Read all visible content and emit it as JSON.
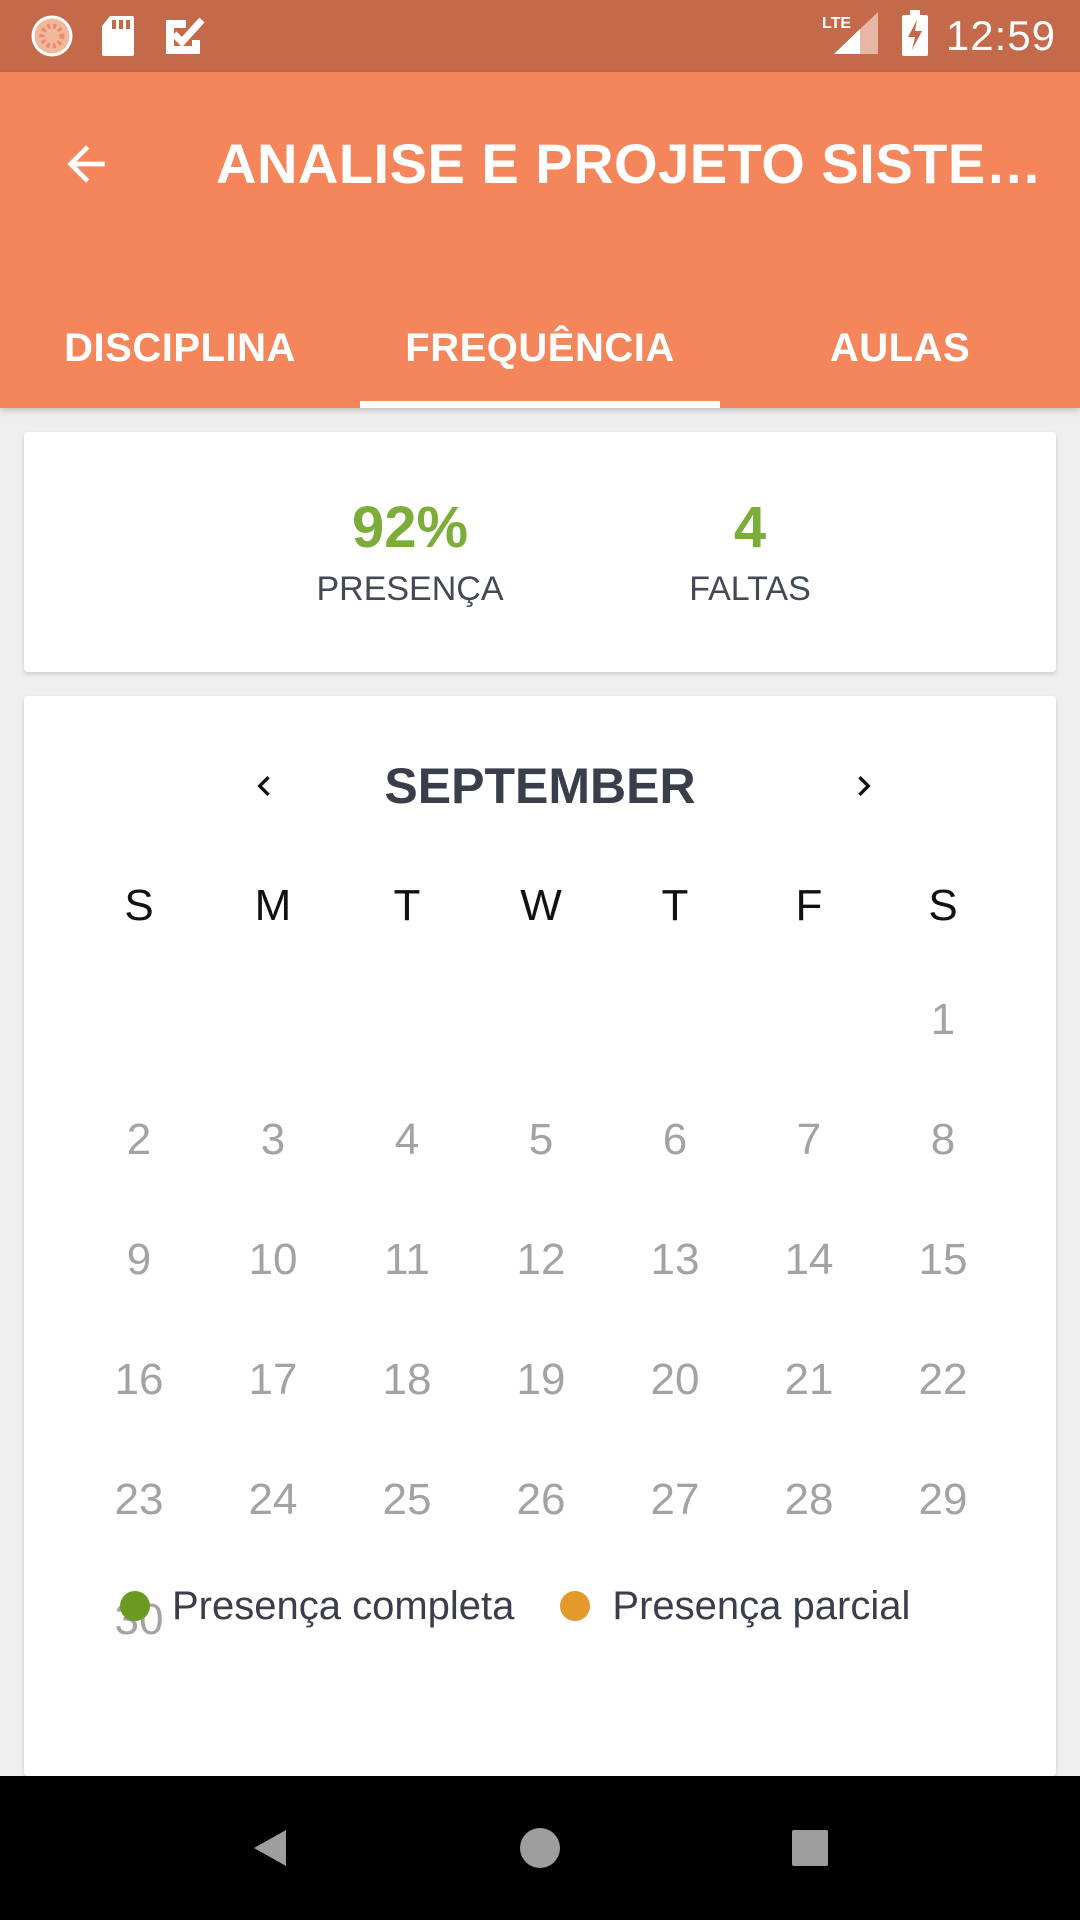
{
  "status_bar": {
    "icons": [
      "spinner-icon",
      "sd-card-icon",
      "check-icon"
    ],
    "network": "LTE",
    "time": "12:59"
  },
  "app_bar": {
    "title": "ANALISE E PROJETO SISTEMAS",
    "tabs": [
      {
        "label": "DISCIPLINA",
        "active": false
      },
      {
        "label": "FREQUÊNCIA",
        "active": true
      },
      {
        "label": "AULAS",
        "active": false
      }
    ]
  },
  "summary": {
    "presence_value": "92%",
    "presence_label": "PRESENÇA",
    "absences_value": "4",
    "absences_label": "FALTAS"
  },
  "calendar": {
    "month": "SEPTEMBER",
    "weekdays": [
      "S",
      "M",
      "T",
      "W",
      "T",
      "F",
      "S"
    ],
    "start_weekday_index": 6,
    "days_in_month": 30
  },
  "legend": {
    "items": [
      {
        "label": "Presença completa",
        "color": "#6a9a1f"
      },
      {
        "label": "Presença parcial",
        "color": "#e39a2b"
      }
    ]
  },
  "colors": {
    "status_bar": "#c4694a",
    "app_bar": "#f5855a",
    "accent_green": "#7cad3a"
  }
}
